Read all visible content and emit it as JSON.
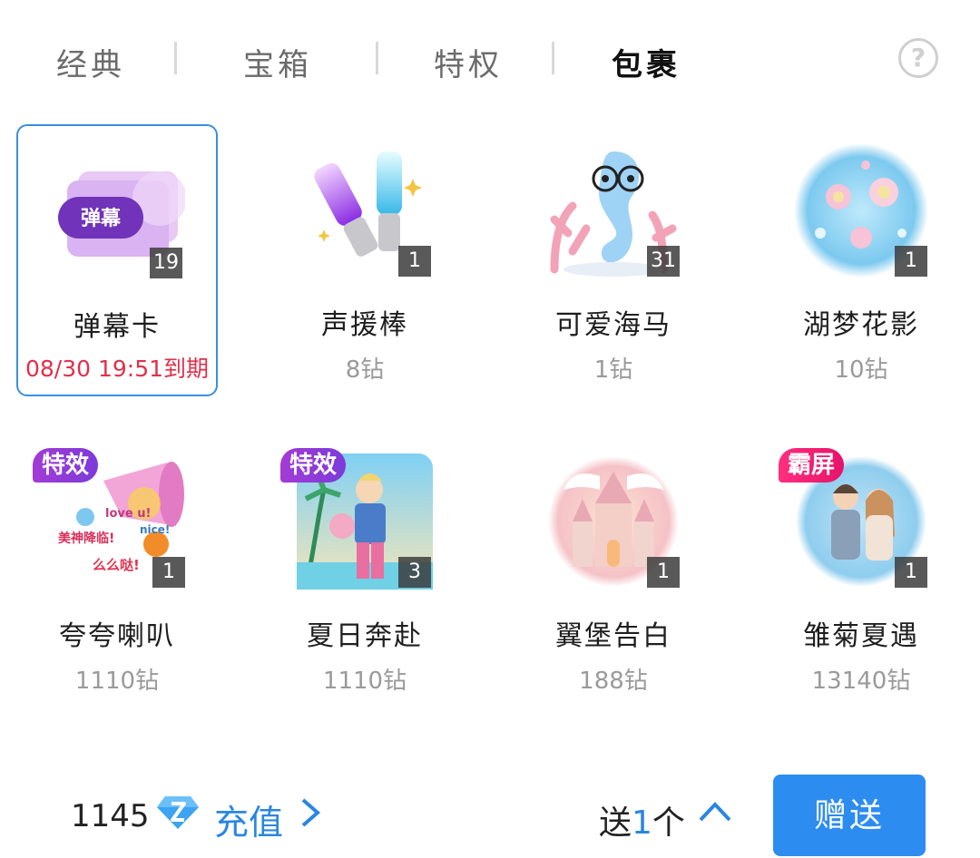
{
  "tabs": [
    {
      "label": "经典"
    },
    {
      "label": "宝箱"
    },
    {
      "label": "特权"
    },
    {
      "label": "包裹"
    }
  ],
  "help_symbol": "?",
  "items": [
    {
      "name": "弹幕卡",
      "price": "08/30 19:51到期",
      "count": "19",
      "badge_text": "弹幕"
    },
    {
      "name": "声援棒",
      "price": "8钻",
      "count": "1"
    },
    {
      "name": "可爱海马",
      "price": "1钻",
      "count": "31"
    },
    {
      "name": "湖梦花影",
      "price": "10钻",
      "count": "1"
    },
    {
      "name": "夸夸喇叭",
      "price": "1110钻",
      "count": "1",
      "tag": "特效",
      "sticker_texts": [
        "love u!",
        "nice!",
        "美神降临!",
        "么么哒!"
      ]
    },
    {
      "name": "夏日奔赴",
      "price": "1110钻",
      "count": "3",
      "tag": "特效"
    },
    {
      "name": "翼堡告白",
      "price": "188钻",
      "count": "1"
    },
    {
      "name": "雏菊夏遇",
      "price": "13140钻",
      "count": "1",
      "tag": "霸屏"
    }
  ],
  "bottom": {
    "balance": "1145",
    "recharge_label": "充值",
    "send_prefix": "送",
    "send_count": "1",
    "send_suffix": "个",
    "gift_button": "赠送"
  },
  "colors": {
    "accent": "#2d8cf0",
    "expire": "#e0304a",
    "effect_tag": "#9b3bd6",
    "bully_tag": "#f0287a"
  }
}
